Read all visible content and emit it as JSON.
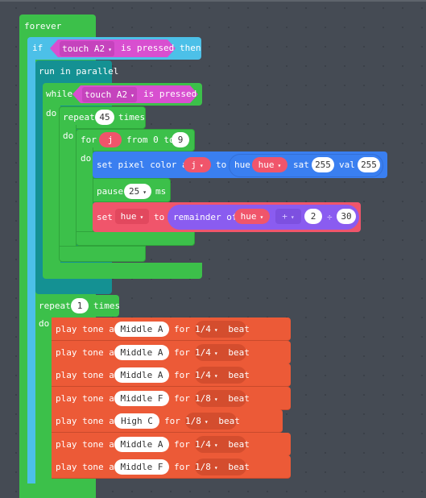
{
  "workspace": {
    "forever_label": "forever",
    "if_block": {
      "if_label": "if",
      "then_label": "then",
      "condition": {
        "sensor": "touch A2",
        "suffix": "is pressed"
      }
    },
    "run_in_parallel_label": "run in parallel",
    "while_block": {
      "while_label": "while",
      "do_label": "do",
      "condition": {
        "sensor": "touch A2",
        "suffix": "is pressed"
      }
    },
    "repeat_block": {
      "repeat_label": "repeat",
      "count": "45",
      "times_label": "times",
      "do_label": "do"
    },
    "for_block": {
      "for_label": "for",
      "var": "j",
      "from_label": "from 0 to",
      "to_value": "9",
      "do_label": "do"
    },
    "set_pixel": {
      "label": "set pixel color at",
      "index": "j",
      "to_label": "to",
      "hue_label": "hue",
      "hue_var": "hue",
      "sat_label": "sat",
      "sat_value": "255",
      "val_label": "val",
      "val_value": "255"
    },
    "pause": {
      "label": "pause",
      "value": "25",
      "unit": "ms"
    },
    "set_hue": {
      "set_label": "set",
      "var": "hue",
      "to_label": "to",
      "remainder_label": "remainder of",
      "operand_var": "hue",
      "operator": "+",
      "operand_value": "2",
      "divide_symbol": "÷",
      "divisor": "30"
    },
    "repeat_tones": {
      "repeat_label": "repeat",
      "count": "1",
      "times_label": "times",
      "do_label": "do"
    },
    "tones": [
      {
        "label": "play tone at",
        "note": "Middle A",
        "for_label": "for",
        "beat": "1/4",
        "beat_label": "beat"
      },
      {
        "label": "play tone at",
        "note": "Middle A",
        "for_label": "for",
        "beat": "1/4",
        "beat_label": "beat"
      },
      {
        "label": "play tone at",
        "note": "Middle A",
        "for_label": "for",
        "beat": "1/4",
        "beat_label": "beat"
      },
      {
        "label": "play tone at",
        "note": "Middle F",
        "for_label": "for",
        "beat": "1/8",
        "beat_label": "beat"
      },
      {
        "label": "play tone at",
        "note": "High C",
        "for_label": "for",
        "beat": "1/8",
        "beat_label": "beat"
      },
      {
        "label": "play tone at",
        "note": "Middle A",
        "for_label": "for",
        "beat": "1/4",
        "beat_label": "beat"
      },
      {
        "label": "play tone at",
        "note": "Middle F",
        "for_label": "for",
        "beat": "1/8",
        "beat_label": "beat"
      }
    ],
    "dropdown_caret": "▾"
  }
}
